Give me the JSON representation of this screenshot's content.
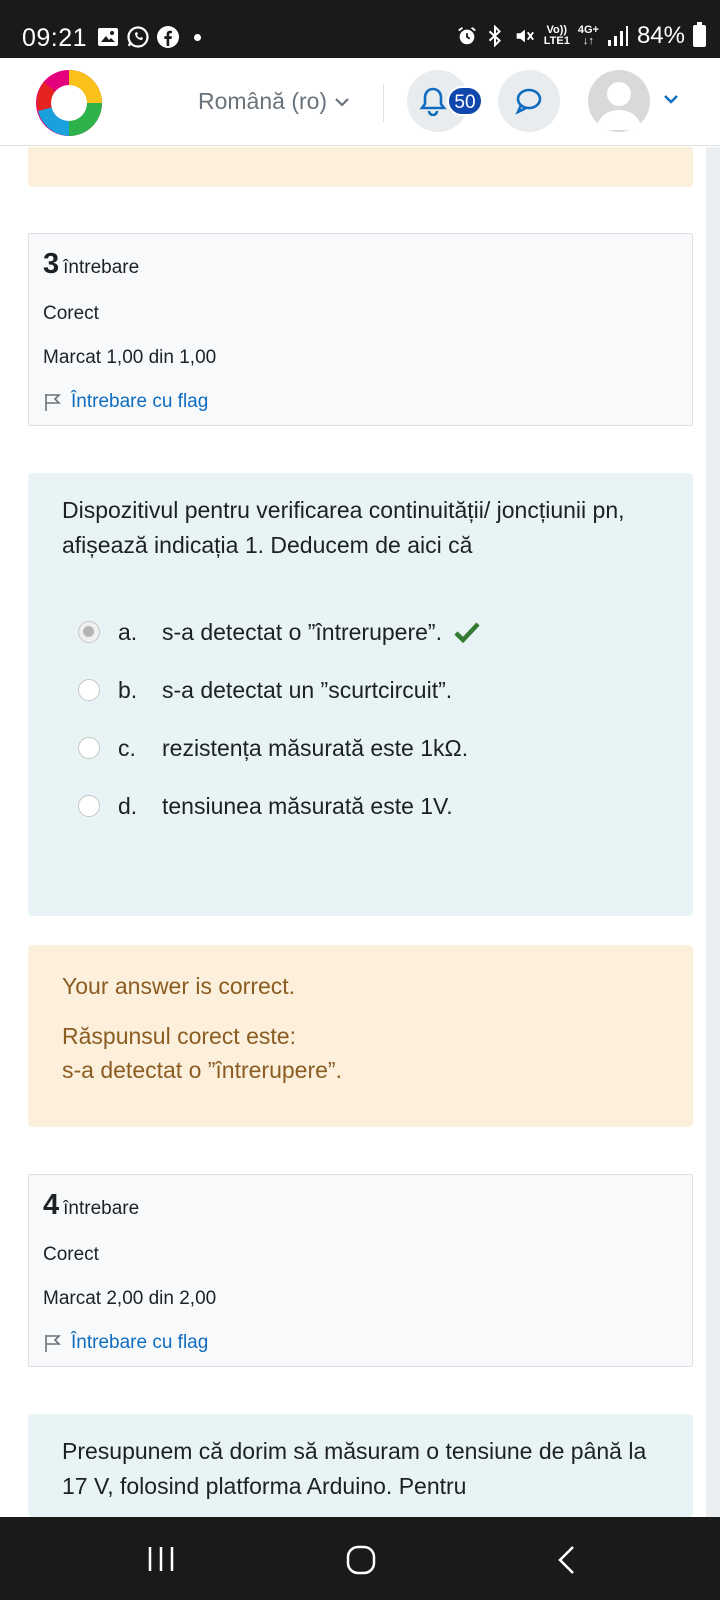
{
  "status_bar": {
    "time": "09:21",
    "left_icons": [
      "gallery-icon",
      "whatsapp-icon",
      "facebook-icon"
    ],
    "volte_top": "Vo))",
    "volte_bottom": "LTE1",
    "network": "4G+",
    "battery": "84%"
  },
  "header": {
    "language": "Română (ro)",
    "notifications_count": "50"
  },
  "question3": {
    "number": "3",
    "label": "întrebare",
    "status": "Corect",
    "mark": "Marcat 1,00 din 1,00",
    "flag_label": "Întrebare cu flag",
    "text": "Dispozitivul pentru verificarea  continuității/ joncțiunii pn,  afișează indicația 1. Deducem de aici că",
    "answers": [
      {
        "letter": "a.",
        "text": "s-a detectat o ”întrerupere”.",
        "selected": true,
        "correct": true
      },
      {
        "letter": "b.",
        "text": "s-a detectat un ”scurtcircuit”.",
        "selected": false
      },
      {
        "letter": "c.",
        "text": "rezistența măsurată este 1kΩ.",
        "selected": false
      },
      {
        "letter": "d.",
        "text": "tensiunea măsurată este 1V.",
        "selected": false
      }
    ],
    "feedback_result": "Your answer is correct.",
    "feedback_correct_label": "Răspunsul corect este:",
    "feedback_correct_answer": "s-a detectat o ”întrerupere”."
  },
  "question4": {
    "number": "4",
    "label": "întrebare",
    "status": "Corect",
    "mark": "Marcat 2,00 din 2,00",
    "flag_label": "Întrebare cu flag",
    "text": "Presupunem că dorim să măsuram o tensiune de până la 17 V, folosind platforma Arduino. Pentru"
  },
  "colors": {
    "accent": "#0f6cbf",
    "badge": "#0f47ad",
    "correct": "#357a32",
    "feedback_bg": "#fcefdc",
    "question_bg": "#e7f3f5"
  }
}
